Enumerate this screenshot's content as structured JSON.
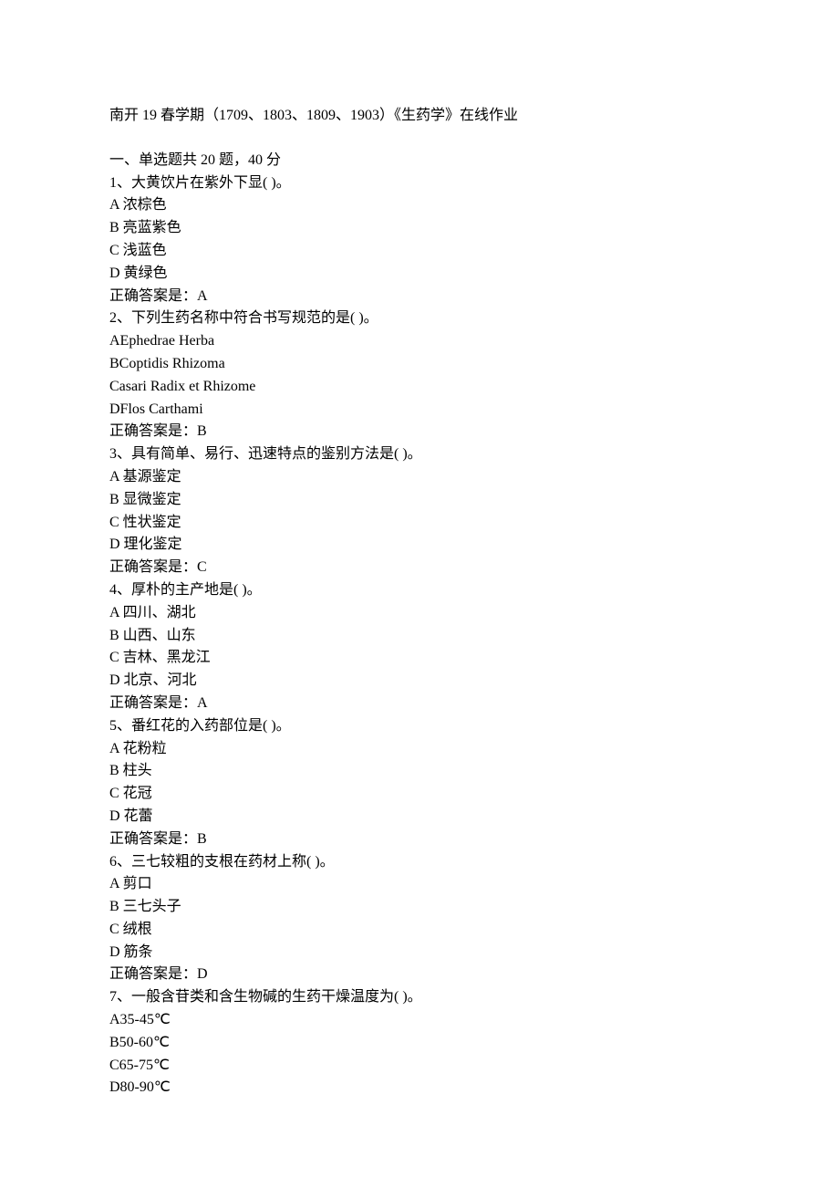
{
  "title": "南开 19 春学期（1709、1803、1809、1903）《生药学》在线作业",
  "section_heading": "一、单选题共 20 题，40 分",
  "questions": [
    {
      "number": "1",
      "stem": "大黄饮片在紫外下显( )。",
      "options": [
        {
          "label": "A",
          "text": "浓棕色",
          "sep": " "
        },
        {
          "label": "B",
          "text": "亮蓝紫色",
          "sep": " "
        },
        {
          "label": "C",
          "text": "浅蓝色",
          "sep": " "
        },
        {
          "label": "D",
          "text": "黄绿色",
          "sep": " "
        }
      ],
      "answer_label": "正确答案是：",
      "answer": "A"
    },
    {
      "number": "2",
      "stem": "下列生药名称中符合书写规范的是( )。",
      "options": [
        {
          "label": "A",
          "text": "Ephedrae Herba",
          "sep": ""
        },
        {
          "label": "B",
          "text": "Coptidis Rhizoma",
          "sep": ""
        },
        {
          "label": "C",
          "text": "asari Radix et Rhizome",
          "sep": ""
        },
        {
          "label": "D",
          "text": "Flos Carthami",
          "sep": ""
        }
      ],
      "answer_label": "正确答案是：",
      "answer": "B"
    },
    {
      "number": "3",
      "stem": "具有简单、易行、迅速特点的鉴别方法是( )。",
      "options": [
        {
          "label": "A",
          "text": "基源鉴定",
          "sep": " "
        },
        {
          "label": "B",
          "text": "显微鉴定",
          "sep": " "
        },
        {
          "label": "C",
          "text": "性状鉴定",
          "sep": " "
        },
        {
          "label": "D",
          "text": "理化鉴定",
          "sep": " "
        }
      ],
      "answer_label": "正确答案是：",
      "answer": "C"
    },
    {
      "number": "4",
      "stem": "厚朴的主产地是( )。",
      "options": [
        {
          "label": "A",
          "text": "四川、湖北",
          "sep": " "
        },
        {
          "label": "B",
          "text": "山西、山东",
          "sep": " "
        },
        {
          "label": "C",
          "text": "吉林、黑龙江",
          "sep": " "
        },
        {
          "label": "D",
          "text": "北京、河北",
          "sep": " "
        }
      ],
      "answer_label": "正确答案是：",
      "answer": "A"
    },
    {
      "number": "5",
      "stem": "番红花的入药部位是( )。",
      "options": [
        {
          "label": "A",
          "text": "花粉粒",
          "sep": " "
        },
        {
          "label": "B",
          "text": "柱头",
          "sep": " "
        },
        {
          "label": "C",
          "text": "花冠",
          "sep": " "
        },
        {
          "label": "D",
          "text": "花蕾",
          "sep": " "
        }
      ],
      "answer_label": "正确答案是：",
      "answer": "B"
    },
    {
      "number": "6",
      "stem": "三七较粗的支根在药材上称( )。",
      "options": [
        {
          "label": "A",
          "text": "剪口",
          "sep": " "
        },
        {
          "label": "B",
          "text": "三七头子",
          "sep": " "
        },
        {
          "label": "C",
          "text": "绒根",
          "sep": " "
        },
        {
          "label": "D",
          "text": "筋条",
          "sep": " "
        }
      ],
      "answer_label": "正确答案是：",
      "answer": "D"
    },
    {
      "number": "7",
      "stem": "一般含苷类和含生物碱的生药干燥温度为( )。",
      "options": [
        {
          "label": "A",
          "text": "35-45℃",
          "sep": ""
        },
        {
          "label": "B",
          "text": "50-60℃",
          "sep": ""
        },
        {
          "label": "C",
          "text": "65-75℃",
          "sep": ""
        },
        {
          "label": "D",
          "text": "80-90℃",
          "sep": ""
        }
      ],
      "answer_label": "",
      "answer": ""
    }
  ]
}
